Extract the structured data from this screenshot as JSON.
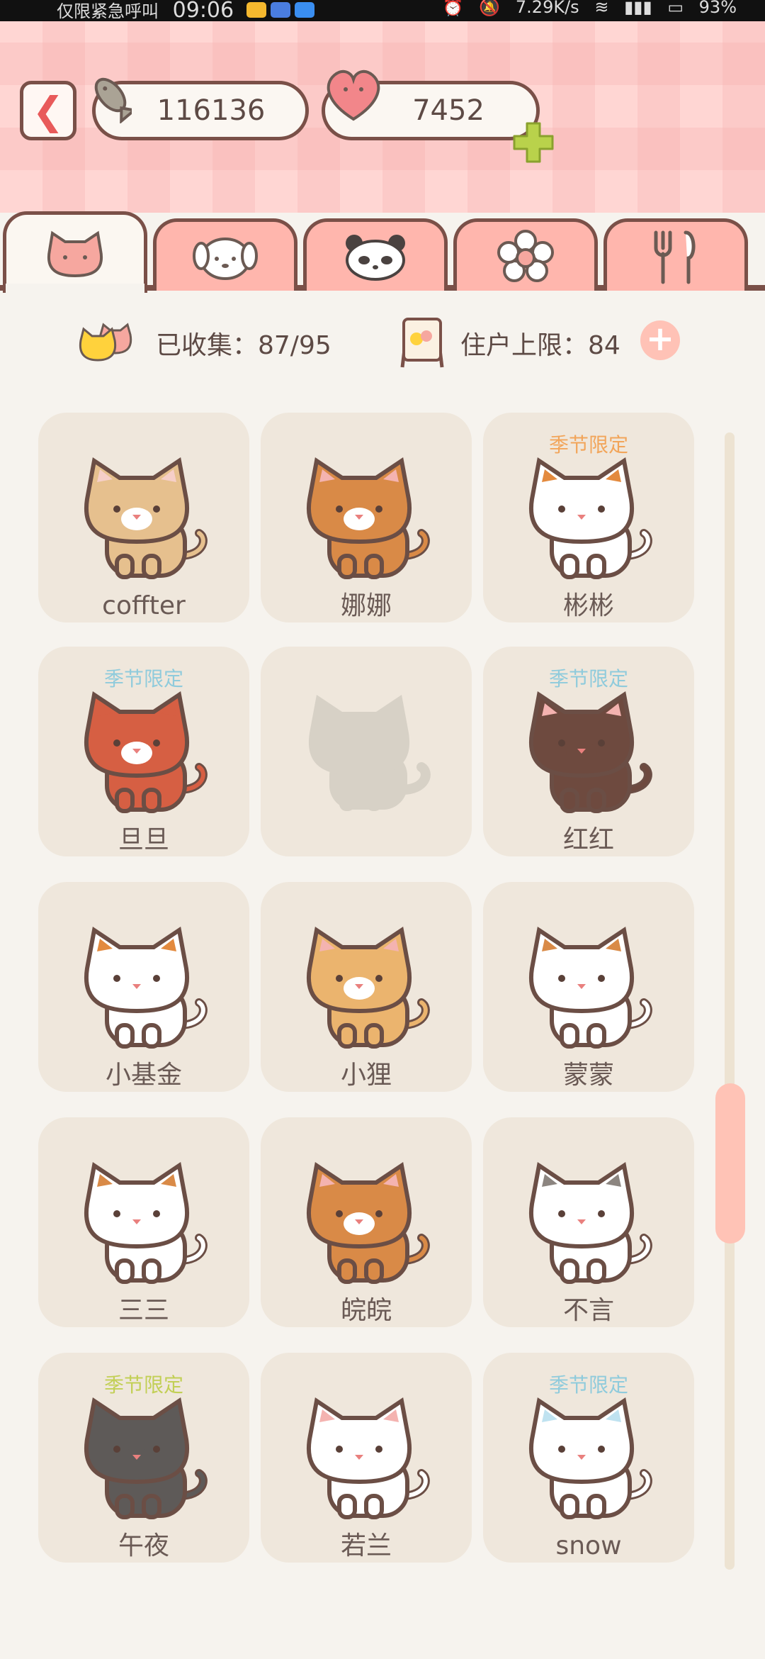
{
  "status_bar": {
    "left_text": "仅限紧急呼叫",
    "time": "09:06",
    "speed": "7.29K/s",
    "battery": "93%"
  },
  "currency": {
    "fish": "116136",
    "hearts": "7452"
  },
  "tabs": [
    {
      "name": "cat"
    },
    {
      "name": "dog"
    },
    {
      "name": "panda"
    },
    {
      "name": "flower"
    },
    {
      "name": "food"
    }
  ],
  "stats": {
    "collected_label": "已收集：87/95",
    "limit_label": "住户上限：84"
  },
  "colors": {
    "season_orange": "#f2a55a",
    "season_blue": "#8fcbdc",
    "season_green": "#c2cf55"
  },
  "cats": [
    {
      "name": "coffter",
      "badge": "",
      "badge_color": "",
      "body": "#e6c08e",
      "ear": "#f6cfc8",
      "face": "#ffffff"
    },
    {
      "name": "娜娜",
      "badge": "",
      "badge_color": "",
      "body": "#d98a47",
      "ear": "#f4b3b0",
      "face": "#ffffff"
    },
    {
      "name": "彬彬",
      "badge": "季节限定",
      "badge_color": "#f2a55a",
      "body": "#ffffff",
      "ear": "#e38a3e",
      "face": "#ffffff"
    },
    {
      "name": "旦旦",
      "badge": "季节限定",
      "badge_color": "#8fcbdc",
      "body": "#d65f43",
      "ear": "#d65f43",
      "face": "#ffffff"
    },
    {
      "name": "",
      "badge": "",
      "badge_color": "",
      "body": "#d7d1c6",
      "ear": "#d7d1c6",
      "face": "#d7d1c6",
      "locked": true
    },
    {
      "name": "红红",
      "badge": "季节限定",
      "badge_color": "#8fcbdc",
      "body": "#6e4a3f",
      "ear": "#f4b3b0",
      "face": "#6e4a3f"
    },
    {
      "name": "小基金",
      "badge": "",
      "badge_color": "",
      "body": "#ffffff",
      "ear": "#e38a3e",
      "face": "#ffffff"
    },
    {
      "name": "小狸",
      "badge": "",
      "badge_color": "",
      "body": "#ebb46e",
      "ear": "#f4b3b0",
      "face": "#ffffff"
    },
    {
      "name": "蒙蒙",
      "badge": "",
      "badge_color": "",
      "body": "#ffffff",
      "ear": "#d98a47",
      "face": "#ffffff"
    },
    {
      "name": "三三",
      "badge": "",
      "badge_color": "",
      "body": "#ffffff",
      "ear": "#d98a47",
      "face": "#ffffff"
    },
    {
      "name": "皖皖",
      "badge": "",
      "badge_color": "",
      "body": "#d98a47",
      "ear": "#f4b3b0",
      "face": "#ffffff"
    },
    {
      "name": "不言",
      "badge": "",
      "badge_color": "",
      "body": "#ffffff",
      "ear": "#8c8580",
      "face": "#ffffff"
    },
    {
      "name": "午夜",
      "badge": "季节限定",
      "badge_color": "#c2cf55",
      "body": "#5e5a58",
      "ear": "#5e5a58",
      "face": "#5e5a58"
    },
    {
      "name": "若兰",
      "badge": "",
      "badge_color": "",
      "body": "#ffffff",
      "ear": "#f4b3b0",
      "face": "#ffffff"
    },
    {
      "name": "snow",
      "badge": "季节限定",
      "badge_color": "#8fcbdc",
      "body": "#ffffff",
      "ear": "#bfe2f0",
      "face": "#ffffff"
    }
  ]
}
